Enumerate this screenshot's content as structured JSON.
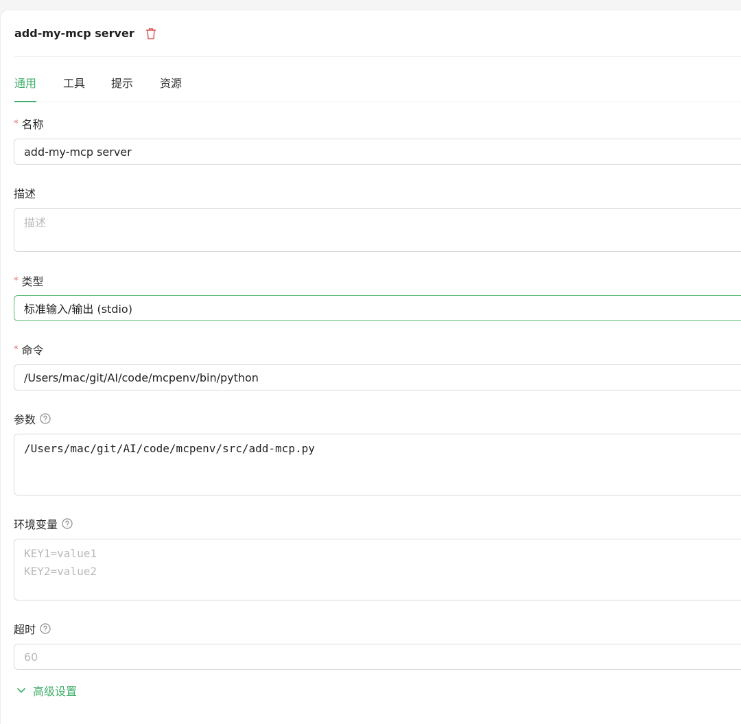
{
  "header": {
    "title": "add-my-mcp server"
  },
  "tabs": [
    {
      "label": "通用",
      "active": true
    },
    {
      "label": "工具"
    },
    {
      "label": "提示"
    },
    {
      "label": "资源"
    }
  ],
  "form": {
    "name": {
      "label": "名称",
      "required": true,
      "value": "add-my-mcp server"
    },
    "description": {
      "label": "描述",
      "placeholder": "描述"
    },
    "type": {
      "label": "类型",
      "required": true,
      "value": "标准输入/输出 (stdio)"
    },
    "command": {
      "label": "命令",
      "required": true,
      "value": "/Users/mac/git/AI/code/mcpenv/bin/python"
    },
    "args": {
      "label": "参数",
      "value": "/Users/mac/git/AI/code/mcpenv/src/add-mcp.py"
    },
    "env": {
      "label": "环境变量",
      "placeholder_lines": [
        "KEY1=value1",
        "KEY2=value2"
      ]
    },
    "timeout": {
      "label": "超时",
      "placeholder": "60"
    }
  },
  "advanced": {
    "label": "高级设置"
  },
  "colors": {
    "accent": "#3fae6a",
    "required": "#e86a6a",
    "delete": "#e05555"
  },
  "icons": {
    "delete": "trash-icon",
    "help": "question-circle-icon",
    "expand": "chevron-down-icon"
  }
}
